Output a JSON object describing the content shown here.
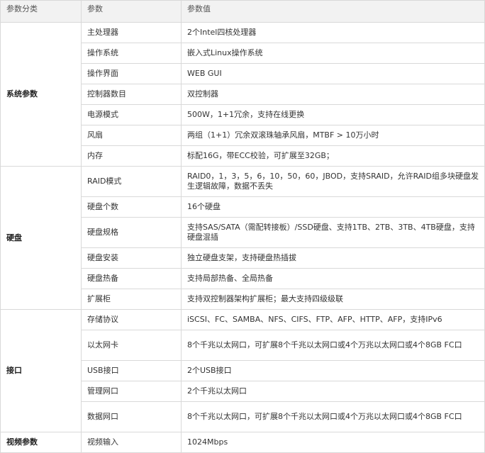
{
  "headers": {
    "category": "参数分类",
    "param": "参数",
    "value": "参数值"
  },
  "groups": [
    {
      "category": "系统参数",
      "rows": [
        {
          "param": "主处理器",
          "value": "2个Intel四核处理器"
        },
        {
          "param": "操作系统",
          "value": "嵌入式Linux操作系统"
        },
        {
          "param": "操作界面",
          "value": "WEB GUI"
        },
        {
          "param": "控制器数目",
          "value": "双控制器"
        },
        {
          "param": "电源模式",
          "value": "500W，1+1冗余，支持在线更换"
        },
        {
          "param": "风扇",
          "value": "两组（1+1）冗余双滚珠轴承风扇，MTBF > 10万小时"
        },
        {
          "param": "内存",
          "value": "标配16G，带ECC校验，可扩展至32GB；"
        }
      ]
    },
    {
      "category": "硬盘",
      "rows": [
        {
          "param": "RAID模式",
          "value": "RAID0，1，3，5，6，10，50，60，JBOD，支持SRAID，允许RAID组多块硬盘发生逻辑故障，数据不丢失"
        },
        {
          "param": "硬盘个数",
          "value": "16个硬盘"
        },
        {
          "param": "硬盘规格",
          "value": "支持SAS/SATA（需配转接板）/SSD硬盘、支持1TB、2TB、3TB、4TB硬盘，支持硬盘混插"
        },
        {
          "param": "硬盘安装",
          "value": "独立硬盘支架，支持硬盘热插拔"
        },
        {
          "param": "硬盘热备",
          "value": "支持局部热备、全局热备"
        },
        {
          "param": "扩展柜",
          "value": "支持双控制器架构扩展柜；最大支持四级级联"
        }
      ]
    },
    {
      "category": "接口",
      "rows": [
        {
          "param": "存储协议",
          "value": "iSCSI、FC、SAMBA、NFS、CIFS、FTP、AFP、HTTP、AFP，支持IPv6"
        },
        {
          "param": "以太网卡",
          "value": "8个千兆以太网口，可扩展8个千兆以太网口或4个万兆以太网口或4个8GB FC口"
        },
        {
          "param": "USB接口",
          "value": "2个USB接口"
        },
        {
          "param": "管理网口",
          "value": "2个千兆以太网口"
        },
        {
          "param": "数据网口",
          "value": "8个千兆以太网口，可扩展8个千兆以太网口或4个万兆以太网口或4个8GB FC口"
        }
      ]
    },
    {
      "category": "视频参数",
      "rows": [
        {
          "param": "视频输入",
          "value": "1024Mbps"
        }
      ]
    }
  ]
}
